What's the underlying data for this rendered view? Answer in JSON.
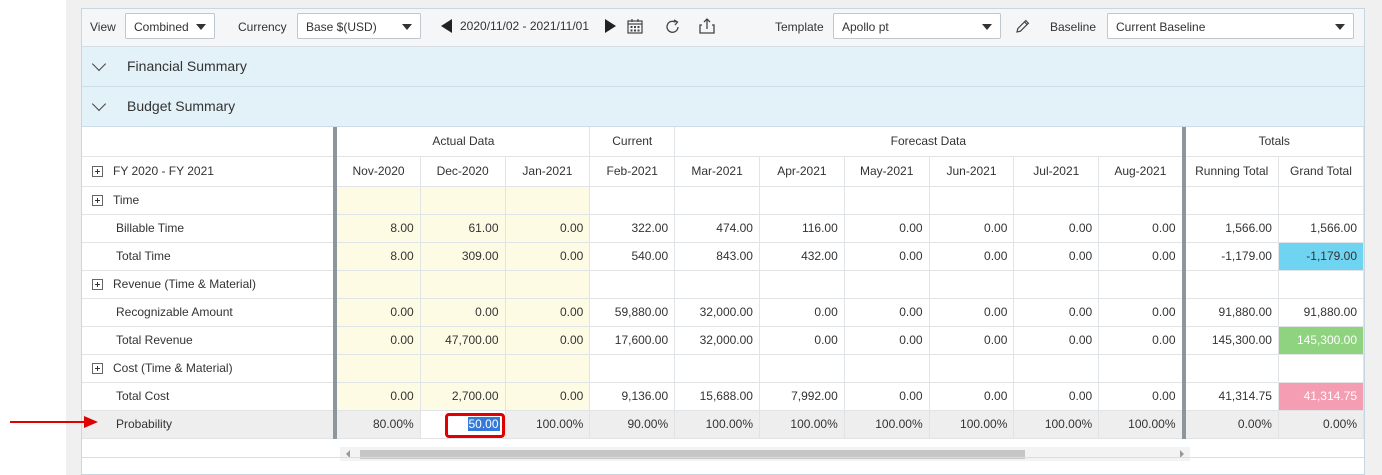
{
  "toolbar": {
    "view_label": "View",
    "view_value": "Combined",
    "currency_label": "Currency",
    "currency_value": "Base $(USD)",
    "date_range": "2020/11/02 - 2021/11/01",
    "template_label": "Template",
    "template_value": "Apollo pt",
    "baseline_label": "Baseline",
    "baseline_value": "Current Baseline"
  },
  "sections": [
    {
      "title": "Financial Summary"
    },
    {
      "title": "Budget Summary"
    }
  ],
  "grid": {
    "period_label": "FY 2020 - FY 2021",
    "groups": {
      "actual": "Actual Data",
      "current": "Current",
      "forecast": "Forecast Data",
      "totals": "Totals"
    },
    "columns": [
      "Nov-2020",
      "Dec-2020",
      "Jan-2021",
      "Feb-2021",
      "Mar-2021",
      "Apr-2021",
      "May-2021",
      "Jun-2021",
      "Jul-2021",
      "Aug-2021"
    ],
    "totals_columns": [
      "Running Total",
      "Grand Total"
    ],
    "rows": [
      {
        "label": "Time",
        "group": true,
        "values": [
          "",
          "",
          "",
          "",
          "",
          "",
          "",
          "",
          "",
          ""
        ],
        "totals": [
          "",
          ""
        ]
      },
      {
        "label": "Billable Time",
        "values": [
          "8.00",
          "61.00",
          "0.00",
          "322.00",
          "474.00",
          "116.00",
          "0.00",
          "0.00",
          "0.00",
          "0.00"
        ],
        "totals": [
          "1,566.00",
          "1,566.00"
        ]
      },
      {
        "label": "Total Time",
        "values": [
          "8.00",
          "309.00",
          "0.00",
          "540.00",
          "843.00",
          "432.00",
          "0.00",
          "0.00",
          "0.00",
          "0.00"
        ],
        "totals": [
          "-1,179.00",
          "-1,179.00"
        ]
      },
      {
        "label": "Revenue (Time & Material)",
        "group": true,
        "values": [
          "",
          "",
          "",
          "",
          "",
          "",
          "",
          "",
          "",
          ""
        ],
        "totals": [
          "",
          ""
        ]
      },
      {
        "label": "Recognizable Amount",
        "values": [
          "0.00",
          "0.00",
          "0.00",
          "59,880.00",
          "32,000.00",
          "0.00",
          "0.00",
          "0.00",
          "0.00",
          "0.00"
        ],
        "totals": [
          "91,880.00",
          "91,880.00"
        ]
      },
      {
        "label": "Total Revenue",
        "values": [
          "0.00",
          "47,700.00",
          "0.00",
          "17,600.00",
          "32,000.00",
          "0.00",
          "0.00",
          "0.00",
          "0.00",
          "0.00"
        ],
        "totals": [
          "145,300.00",
          "145,300.00"
        ]
      },
      {
        "label": "Cost (Time & Material)",
        "group": true,
        "values": [
          "",
          "",
          "",
          "",
          "",
          "",
          "",
          "",
          "",
          ""
        ],
        "totals": [
          "",
          ""
        ]
      },
      {
        "label": "Total Cost",
        "values": [
          "0.00",
          "2,700.00",
          "0.00",
          "9,136.00",
          "15,688.00",
          "7,992.00",
          "0.00",
          "0.00",
          "0.00",
          "0.00"
        ],
        "totals": [
          "41,314.75",
          "41,314.75"
        ]
      },
      {
        "label": "Probability",
        "values": [
          "80.00%",
          "50.00",
          "100.00%",
          "90.00%",
          "100.00%",
          "100.00%",
          "100.00%",
          "100.00%",
          "100.00%",
          "100.00%"
        ],
        "totals": [
          "0.00%",
          "0.00%"
        ]
      }
    ]
  },
  "colors": {
    "actual_bg": "#fefbe5",
    "cyan": "#6fd4f2",
    "green": "#8fd27f",
    "pink": "#f59db2",
    "highlight": "#e00000"
  }
}
